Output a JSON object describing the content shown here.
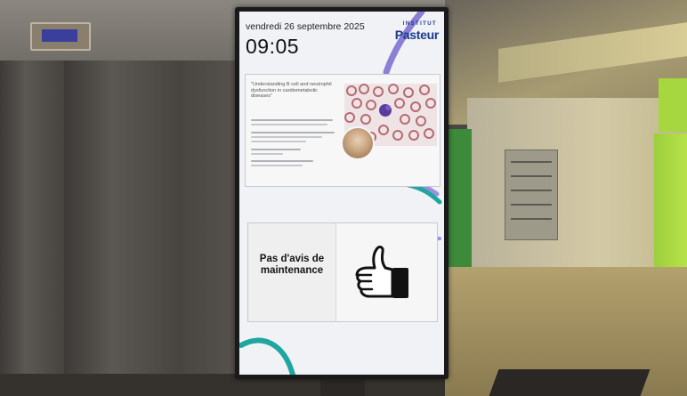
{
  "signage": {
    "date": "vendredi 26 septembre 2025",
    "time": "09:05",
    "logo": {
      "institut": "INSTITUT",
      "name": "Pasteur"
    },
    "seminar": {
      "title": "\"Understanding B cell and neutrophil dysfunction in cardiometabolic diseases\""
    },
    "maintenance": {
      "text": "Pas d'avis de maintenance",
      "icon": "thumbs-up-icon"
    }
  },
  "colors": {
    "brand_blue": "#1a3a8c",
    "accent_purple": "#8b7fd6",
    "accent_teal": "#1fa6a0",
    "corridor_green": "#9dcf3c"
  }
}
